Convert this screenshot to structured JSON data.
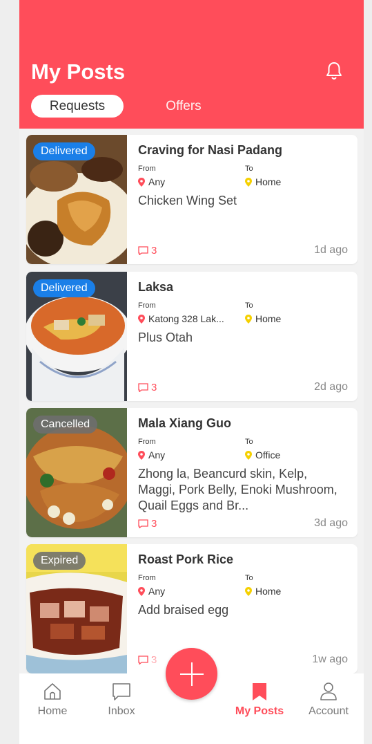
{
  "header": {
    "title": "My Posts",
    "tabs": [
      {
        "label": "Requests",
        "active": true
      },
      {
        "label": "Offers",
        "active": false
      }
    ],
    "color": "#ff4d5a"
  },
  "labels": {
    "from": "From",
    "to": "To"
  },
  "posts": [
    {
      "status": "Delivered",
      "title": "Craving for Nasi Padang",
      "from": "Any",
      "to": "Home",
      "description": "Chicken Wing Set",
      "comments": "3",
      "time": "1d ago"
    },
    {
      "status": "Delivered",
      "title": "Laksa",
      "from": "Katong 328 Lak...",
      "to": "Home",
      "description": "Plus Otah",
      "comments": "3",
      "time": "2d ago"
    },
    {
      "status": "Cancelled",
      "title": "Mala Xiang Guo",
      "from": "Any",
      "to": "Office",
      "description": "Zhong la, Beancurd skin, Kelp, Maggi, Pork Belly, Enoki Mushroom, Quail Eggs and Br...",
      "comments": "3",
      "time": "3d ago"
    },
    {
      "status": "Expired",
      "title": "Roast Pork Rice",
      "from": "Any",
      "to": "Home",
      "description": "Add braised egg",
      "comments": "3",
      "time": "1w ago"
    }
  ],
  "nav": {
    "home": "Home",
    "inbox": "Inbox",
    "my_posts": "My Posts",
    "account": "Account"
  },
  "colors": {
    "accent": "#ff4d5a",
    "delivered": "#1a7fe8",
    "muted_badge": "#6e6e6e",
    "from_pin": "#ff4d5a",
    "to_pin": "#f5d000"
  }
}
